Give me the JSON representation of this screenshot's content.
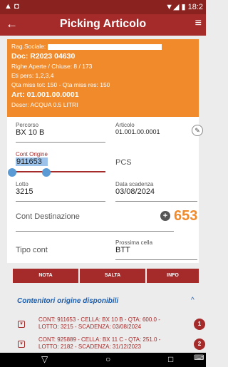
{
  "status": {
    "left_icons": "▲ ◘",
    "right": "▼◢ ▮ 18:2"
  },
  "appbar": {
    "title": "Picking Articolo",
    "back_icon": "←",
    "menu_icon": "≡"
  },
  "info": {
    "rag_label": "Rag.Sociale:",
    "doc": "Doc: R2023 04630",
    "righe": "Righe Aperte / Chiuse: 8 / 173",
    "eti": "Eti pers: 1,2,3,4",
    "qta": "Qta miss tot: 150 - Qta miss res: 150",
    "art": "Art: 01.001.00.0001",
    "descr": "Descr: ACQUA 0.5 LITRI"
  },
  "form": {
    "percorso": {
      "label": "Percorso",
      "value": "BX 10 B"
    },
    "articolo": {
      "label": "Articolo",
      "value": "01.001.00.0001"
    },
    "cont_origine": {
      "label": "Cont Origine",
      "value": "911653"
    },
    "pcs": {
      "label": "PCS"
    },
    "lotto": {
      "label": "Lotto",
      "value": "3215"
    },
    "scadenza": {
      "label": "Data scadenza",
      "value": "03/08/2024"
    },
    "cont_dest": {
      "label": "Cont Destinazione"
    },
    "count": "653",
    "tipo_cont": {
      "label": "Tipo cont"
    },
    "prossima": {
      "label": "Prossima cella",
      "value": "BTT"
    }
  },
  "buttons": {
    "nota": "NOTA",
    "salta": "SALTA",
    "info": "INFO"
  },
  "section": {
    "title": "Contenitori origine disponibili",
    "caret": "^"
  },
  "rows": [
    {
      "line1": "CONT: 911653 - CELLA: BX 10 B - QTA: 600.0 -",
      "line2": "LOTTO: 3215 - SCADENZA: 03/08/2024",
      "badge": "1"
    },
    {
      "line1": "CONT: 925889 - CELLA: BX 11 C - QTA: 251.0 -",
      "line2": "LOTTO: 2182 - SCADENZA: 31/12/2023",
      "badge": "2"
    }
  ],
  "nav": {
    "back": "▽",
    "home": "○",
    "recents": "□",
    "keyboard": "⌨"
  },
  "colors": {
    "primary": "#a52a2a",
    "accent": "#f08a2a",
    "link": "#1c5fb0"
  }
}
